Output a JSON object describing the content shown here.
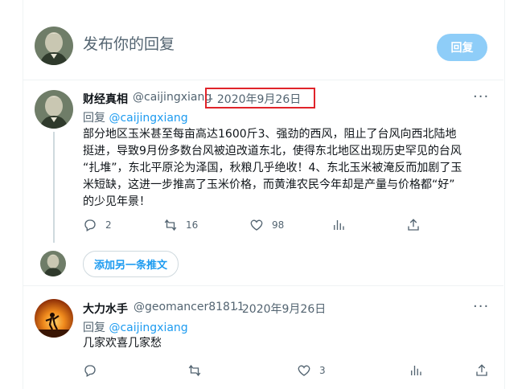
{
  "compose": {
    "placeholder": "发布你的回复",
    "reply_button": "回复"
  },
  "tweet1": {
    "name": "财经真相",
    "handle": "@caijingxiang",
    "date": "· 2020年9月26日",
    "replying_prefix": "回复",
    "replying_to": "@caijingxiang",
    "body": "部分地区玉米甚至每亩高达1600斤3、强劲的西风，阻止了台风向西北陆地\n挺进，导致9月份多数台风被迫改道东北，使得东北地区出现历史罕见的台风\n“扎堆”，东北平原沦为泽国，秋粮几乎绝收！4、东北玉米被淹反而加剧了玉\n米短缺，这进一步推高了玉米价格，而黄淮农民今年却是产量与价格都“好”\n的少见年景！",
    "stats": {
      "replies": "2",
      "retweets": "16",
      "likes": "98"
    },
    "more": "···"
  },
  "add_thread": {
    "label": "添加另一条推文"
  },
  "tweet2": {
    "name": "大力水手",
    "handle": "@geomancer81811",
    "date": "· 2020年9月26日",
    "replying_prefix": "回复",
    "replying_to": "@caijingxiang",
    "body": "几家欢喜几家愁",
    "stats": {
      "replies": "",
      "retweets": "",
      "likes": "3"
    },
    "more": "···"
  },
  "colors": {
    "accent": "#1d9bf0",
    "reply_button_disabled": "#8ecdf8",
    "highlight_box": "#e0242a",
    "secondary_text": "#536471"
  }
}
